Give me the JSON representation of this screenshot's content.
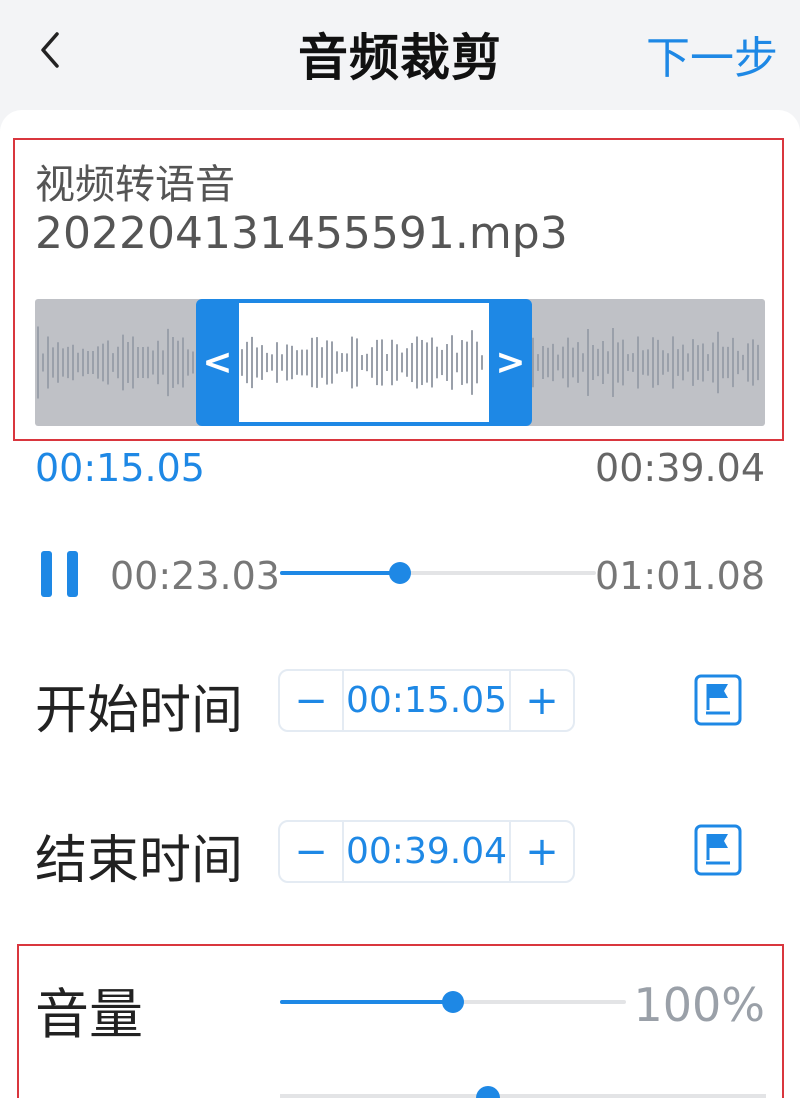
{
  "header": {
    "title": "音频裁剪",
    "next_label": "下一步",
    "back_icon": "chevron-left-icon"
  },
  "file": {
    "name_line1": "视频转语音",
    "name_line2": "202204131455591.mp3"
  },
  "trim": {
    "start_fraction": 0.22,
    "end_fraction": 0.68,
    "range_start": "00:15.05",
    "range_end": "00:39.04",
    "left_handle_glyph": "<",
    "right_handle_glyph": ">"
  },
  "player": {
    "state": "playing",
    "current_time": "00:23.03",
    "total_time": "01:01.08",
    "progress_fraction": 0.38
  },
  "start_row": {
    "label": "开始时间",
    "minus": "−",
    "value": "00:15.05",
    "plus": "+",
    "flag_icon": "flag-marker-icon"
  },
  "end_row": {
    "label": "结束时间",
    "minus": "−",
    "value": "00:39.04",
    "plus": "+",
    "flag_icon": "flag-marker-icon"
  },
  "volume": {
    "label": "音量",
    "percent_text": "100%",
    "level_fraction": 0.5
  },
  "colors": {
    "accent": "#1e88e5",
    "highlight_border": "#d9363e",
    "waveform": "#9aa0aa"
  }
}
